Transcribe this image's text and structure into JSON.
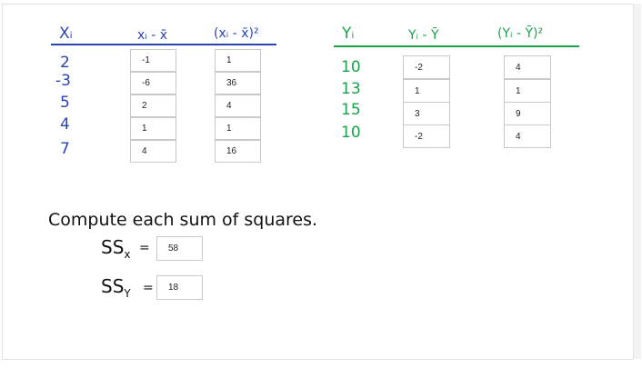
{
  "x_table": {
    "headers": [
      "Xᵢ",
      "xᵢ - x̄",
      "(xᵢ - x̄)²"
    ],
    "values": [
      "2",
      "-3",
      "5",
      "4",
      "7"
    ],
    "deviations": [
      "-1",
      "-6",
      "2",
      "1",
      "4"
    ],
    "squares": [
      "1",
      "36",
      "4",
      "1",
      "16"
    ]
  },
  "y_table": {
    "headers": [
      "Yᵢ",
      "Yᵢ - Ȳ",
      "(Yᵢ - Ȳ)²"
    ],
    "values": [
      "10",
      "13",
      "15",
      "10"
    ],
    "deviations": [
      "-2",
      "1",
      "3",
      "-2"
    ],
    "squares": [
      "4",
      "1",
      "9",
      "4"
    ]
  },
  "prompt": "Compute each sum of squares.",
  "ss": {
    "x_label": "SS",
    "x_sub": "x",
    "x_value": "58",
    "y_label": "SS",
    "y_sub": "Y",
    "y_value": "18",
    "equals": "="
  },
  "colors": {
    "x_table": "#2a45b3",
    "y_table": "#18a24a"
  }
}
